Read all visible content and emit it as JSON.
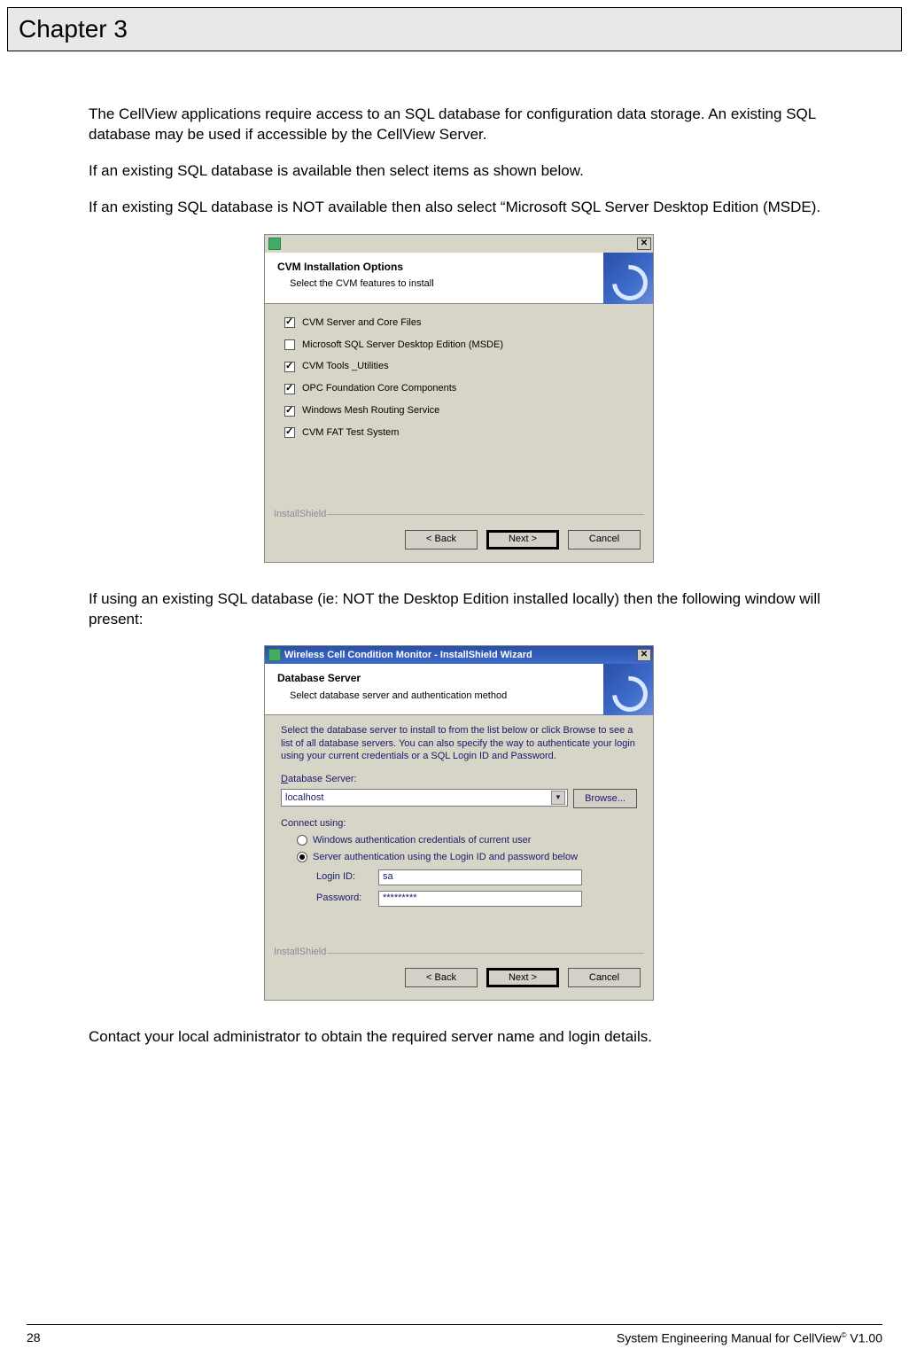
{
  "chapter": "Chapter 3",
  "body": {
    "p1": "The CellView applications require access to an SQL database for configuration data storage.  An existing SQL database may be used if accessible by the CellView Server.",
    "p2": "If an existing SQL database is available then select items as shown below.",
    "p3": "If an existing SQL database is NOT available then also select “Microsoft SQL Server Desktop Edition (MSDE).",
    "p4": "If using an existing SQL database (ie: NOT the Desktop Edition installed locally) then the following window will present:",
    "p5": "Contact your local administrator to obtain the required server name and login details."
  },
  "dlg1": {
    "header_title": "CVM Installation Options",
    "header_sub": "Select the CVM features to install",
    "options": [
      {
        "label": "CVM Server and Core Files",
        "checked": true
      },
      {
        "label": "Microsoft SQL Server Desktop Edition (MSDE)",
        "checked": false
      },
      {
        "label": "CVM Tools _Utilities",
        "checked": true
      },
      {
        "label": "OPC Foundation Core Components",
        "checked": true
      },
      {
        "label": "Windows Mesh Routing Service",
        "checked": true
      },
      {
        "label": "CVM FAT Test System",
        "checked": true
      }
    ],
    "installshield": "InstallShield",
    "back": "< Back",
    "next": "Next >",
    "cancel": "Cancel"
  },
  "dlg2": {
    "titlebar": "Wireless Cell Condition Monitor - InstallShield Wizard",
    "header_title": "Database Server",
    "header_sub": "Select database server and authentication method",
    "info": "Select the database server to install to from the list below or click Browse to see a list of all database servers. You can also specify the way to authenticate your login using your current credentials or a SQL Login ID and Password.",
    "db_label": "Database Server:",
    "db_value": "localhost",
    "browse": "Browse...",
    "connect_label": "Connect using:",
    "radio1": "Windows authentication credentials of current user",
    "radio2": "Server authentication using the Login ID and password below",
    "login_label": "Login ID:",
    "login_value": "sa",
    "pass_label": "Password:",
    "pass_value": "*********",
    "installshield": "InstallShield",
    "back": "< Back",
    "next": "Next >",
    "cancel": "Cancel"
  },
  "footer": {
    "page": "28",
    "doc": "System Engineering Manual for CellView",
    "ver": " V1.00"
  }
}
